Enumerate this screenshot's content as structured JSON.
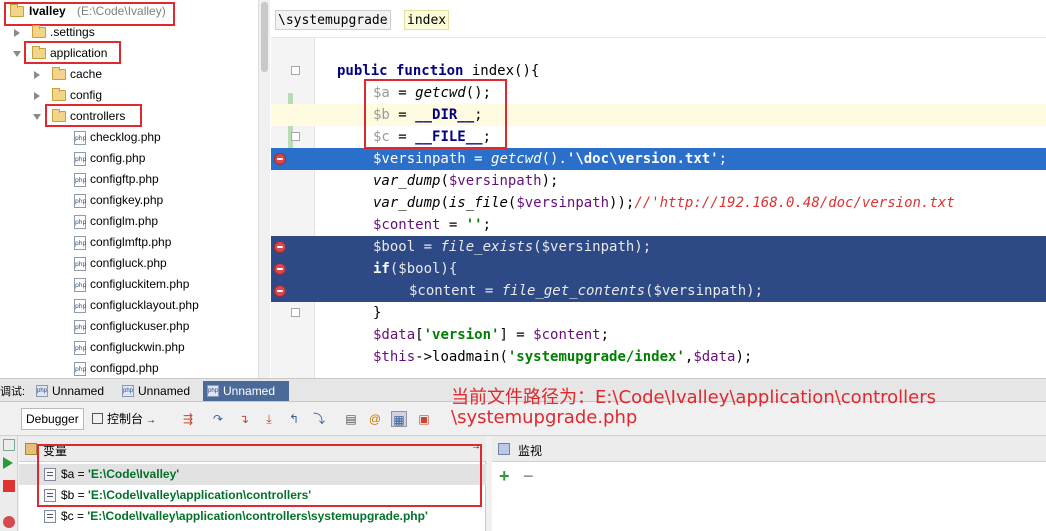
{
  "tree": {
    "root": {
      "name": "Ivalley",
      "path": "(E:\\Code\\Ivalley)"
    },
    "items": [
      {
        "label": ".settings",
        "type": "folder"
      },
      {
        "label": "application",
        "type": "folder"
      },
      {
        "label": "cache",
        "type": "folder"
      },
      {
        "label": "config",
        "type": "folder"
      },
      {
        "label": "controllers",
        "type": "folder"
      },
      {
        "label": "checklog.php",
        "type": "php"
      },
      {
        "label": "config.php",
        "type": "php"
      },
      {
        "label": "configftp.php",
        "type": "php"
      },
      {
        "label": "configkey.php",
        "type": "php"
      },
      {
        "label": "configlm.php",
        "type": "php"
      },
      {
        "label": "configlmftp.php",
        "type": "php"
      },
      {
        "label": "configluck.php",
        "type": "php"
      },
      {
        "label": "configluckitem.php",
        "type": "php"
      },
      {
        "label": "configlucklayout.php",
        "type": "php"
      },
      {
        "label": "configluckuser.php",
        "type": "php"
      },
      {
        "label": "configluckwin.php",
        "type": "php"
      },
      {
        "label": "configpd.php",
        "type": "php"
      }
    ],
    "php_icon_text": "php"
  },
  "editor": {
    "breadcrumb_path": "\\systemupgrade",
    "breadcrumb_function": "index"
  },
  "debug": {
    "panel_label": "调试:",
    "tabs": [
      {
        "label": "Unnamed"
      },
      {
        "label": "Unnamed"
      },
      {
        "label": "Unnamed"
      }
    ],
    "toolbar": {
      "debugger_tab": "Debugger",
      "console_tab": "控制台",
      "console_arrow": "→"
    },
    "variables_title": "变量",
    "variables_pin": "→",
    "watch_title": "监视",
    "watch_add": "+",
    "watch_remove": "−",
    "variables": [
      {
        "name": "$a = ",
        "value": "'E:\\Code\\Ivalley'"
      },
      {
        "name": "$b = ",
        "value": "'E:\\Code\\Ivalley\\application\\controllers'"
      },
      {
        "name": "$c = ",
        "value": "'E:\\Code\\Ivalley\\application\\controllers\\systemupgrade.php'"
      }
    ]
  },
  "annotation": {
    "line1": "当前文件路径为：E:\\Code\\Ivalley\\application\\controllers",
    "line2": "\\systemupgrade.php"
  },
  "colors": {
    "annotation_red": "#e0282e",
    "selection_blue": "#2a6fc9",
    "breakpoint_row": "#2d4a86"
  }
}
